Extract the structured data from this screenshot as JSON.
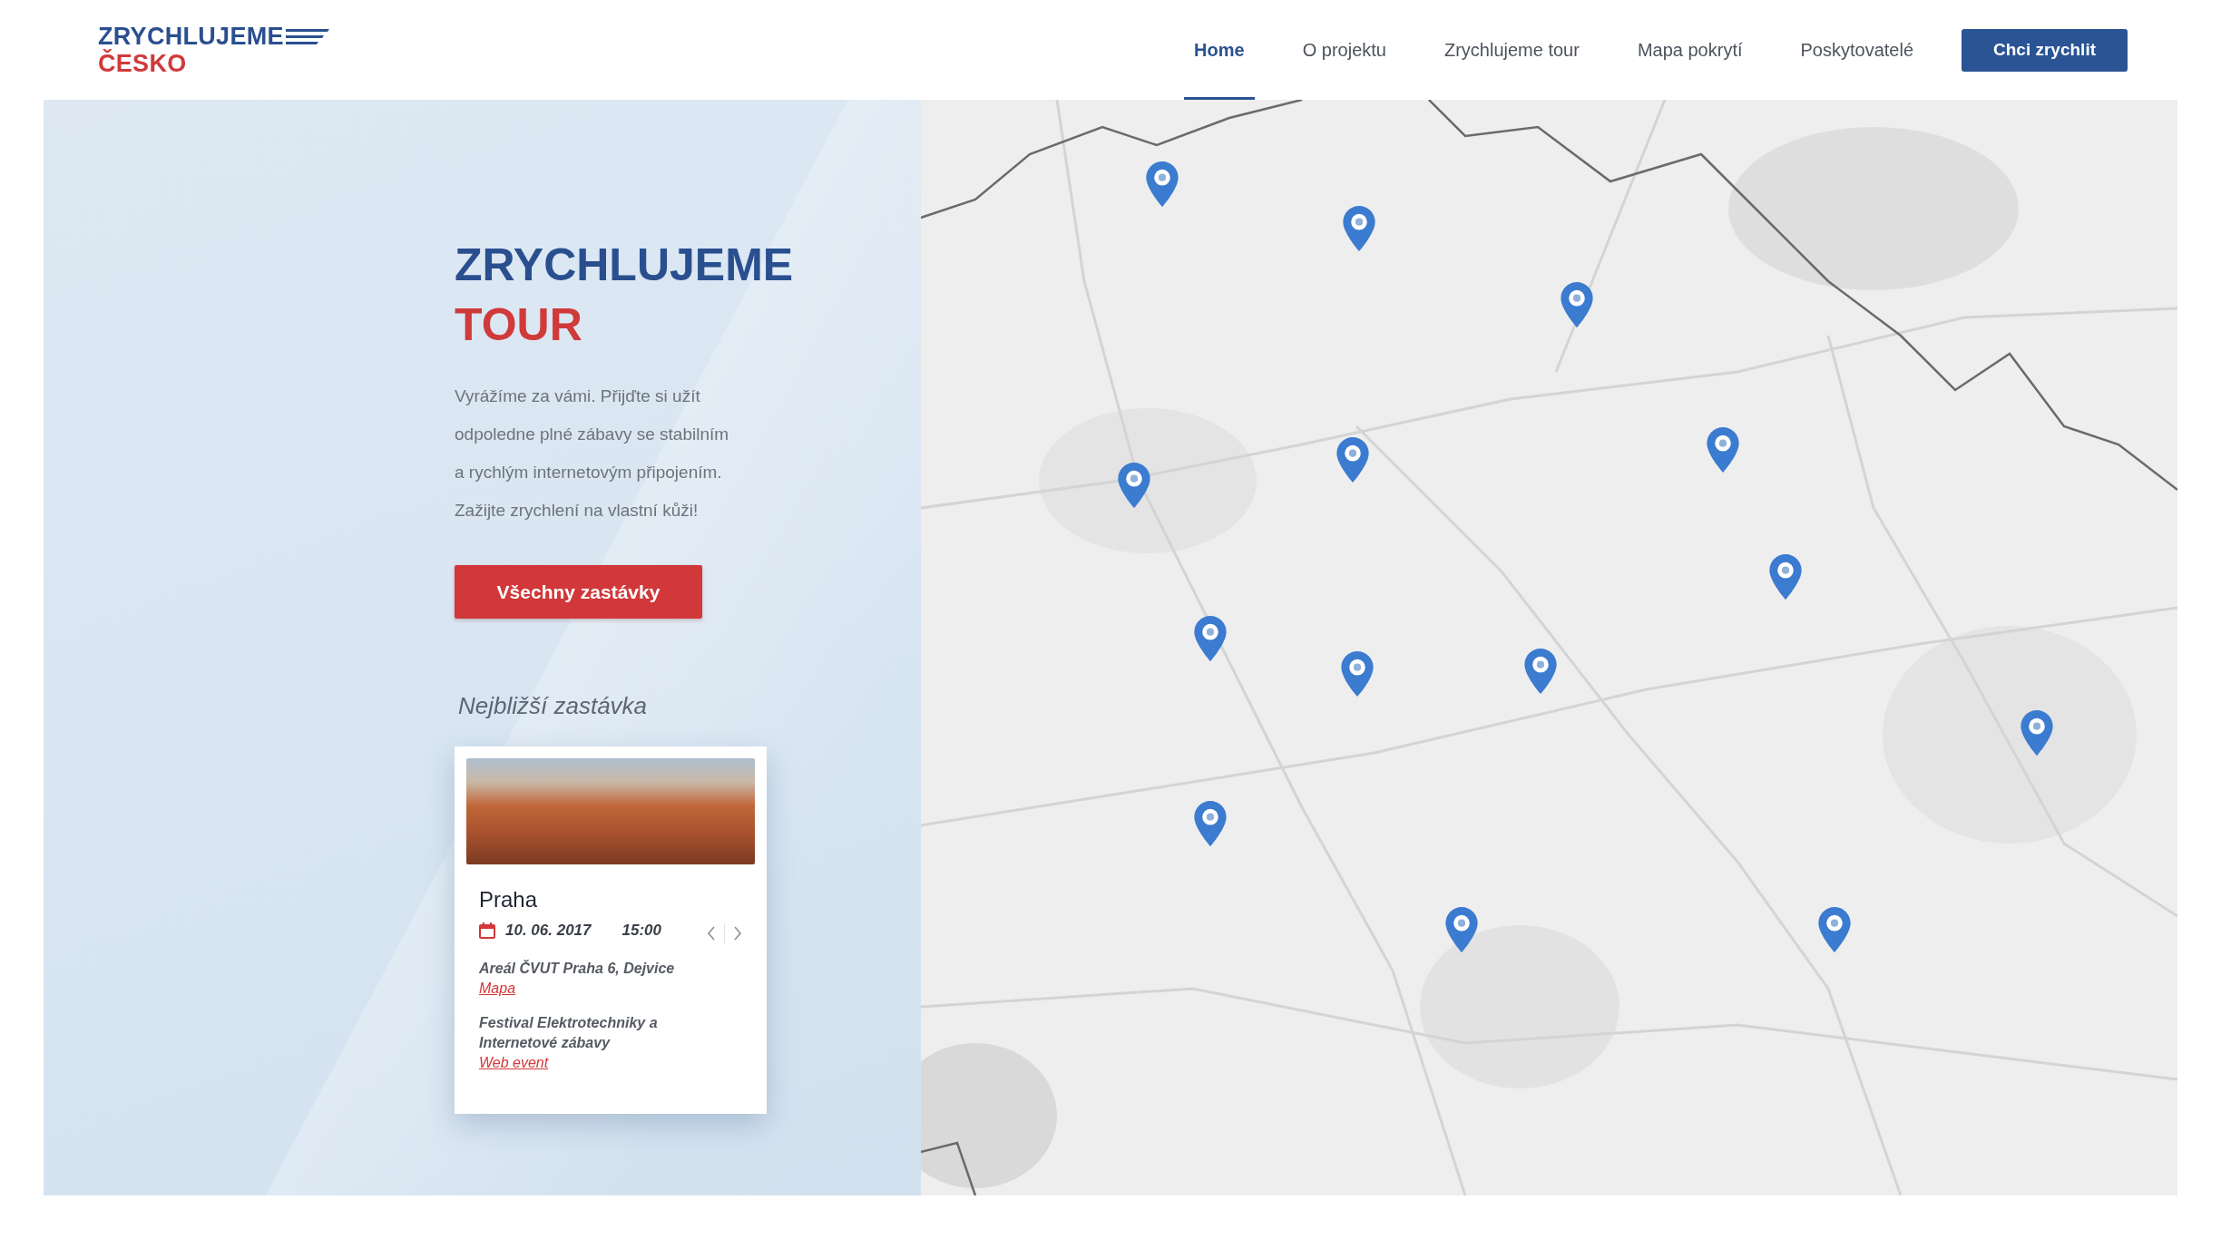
{
  "header": {
    "logo": {
      "title": "ZRYCHLUJEME",
      "subtitle": "ČESKO"
    },
    "nav": [
      {
        "label": "Home",
        "selected": true
      },
      {
        "label": "O projektu",
        "selected": false
      },
      {
        "label": "Zrychlujeme tour",
        "selected": false
      },
      {
        "label": "Mapa pokrytí",
        "selected": false
      },
      {
        "label": "Poskytovatelé",
        "selected": false
      }
    ],
    "cta_button": "Chci zrychlit"
  },
  "hero": {
    "title": "ZRYCHLUJEME",
    "title_accent": "TOUR",
    "text": "Vyrážíme za vámi. Přijďte si užít\nodpoledne plné zábavy se stabilním\na rychlým internetovým připojením.\nZažijte zrychlení na vlastní kůži!",
    "button": "Všechny zastávky",
    "nearest_label": "Nejbližší zastávka",
    "stop_card": {
      "city": "Praha",
      "date": "10. 06. 2017",
      "time": "15:00",
      "address": "Areál ČVUT Praha 6, Dejvice",
      "map_link": "Mapa",
      "event": "Festival Elektrotechniky a Internetové zábavy",
      "event_link": "Web event"
    }
  }
}
